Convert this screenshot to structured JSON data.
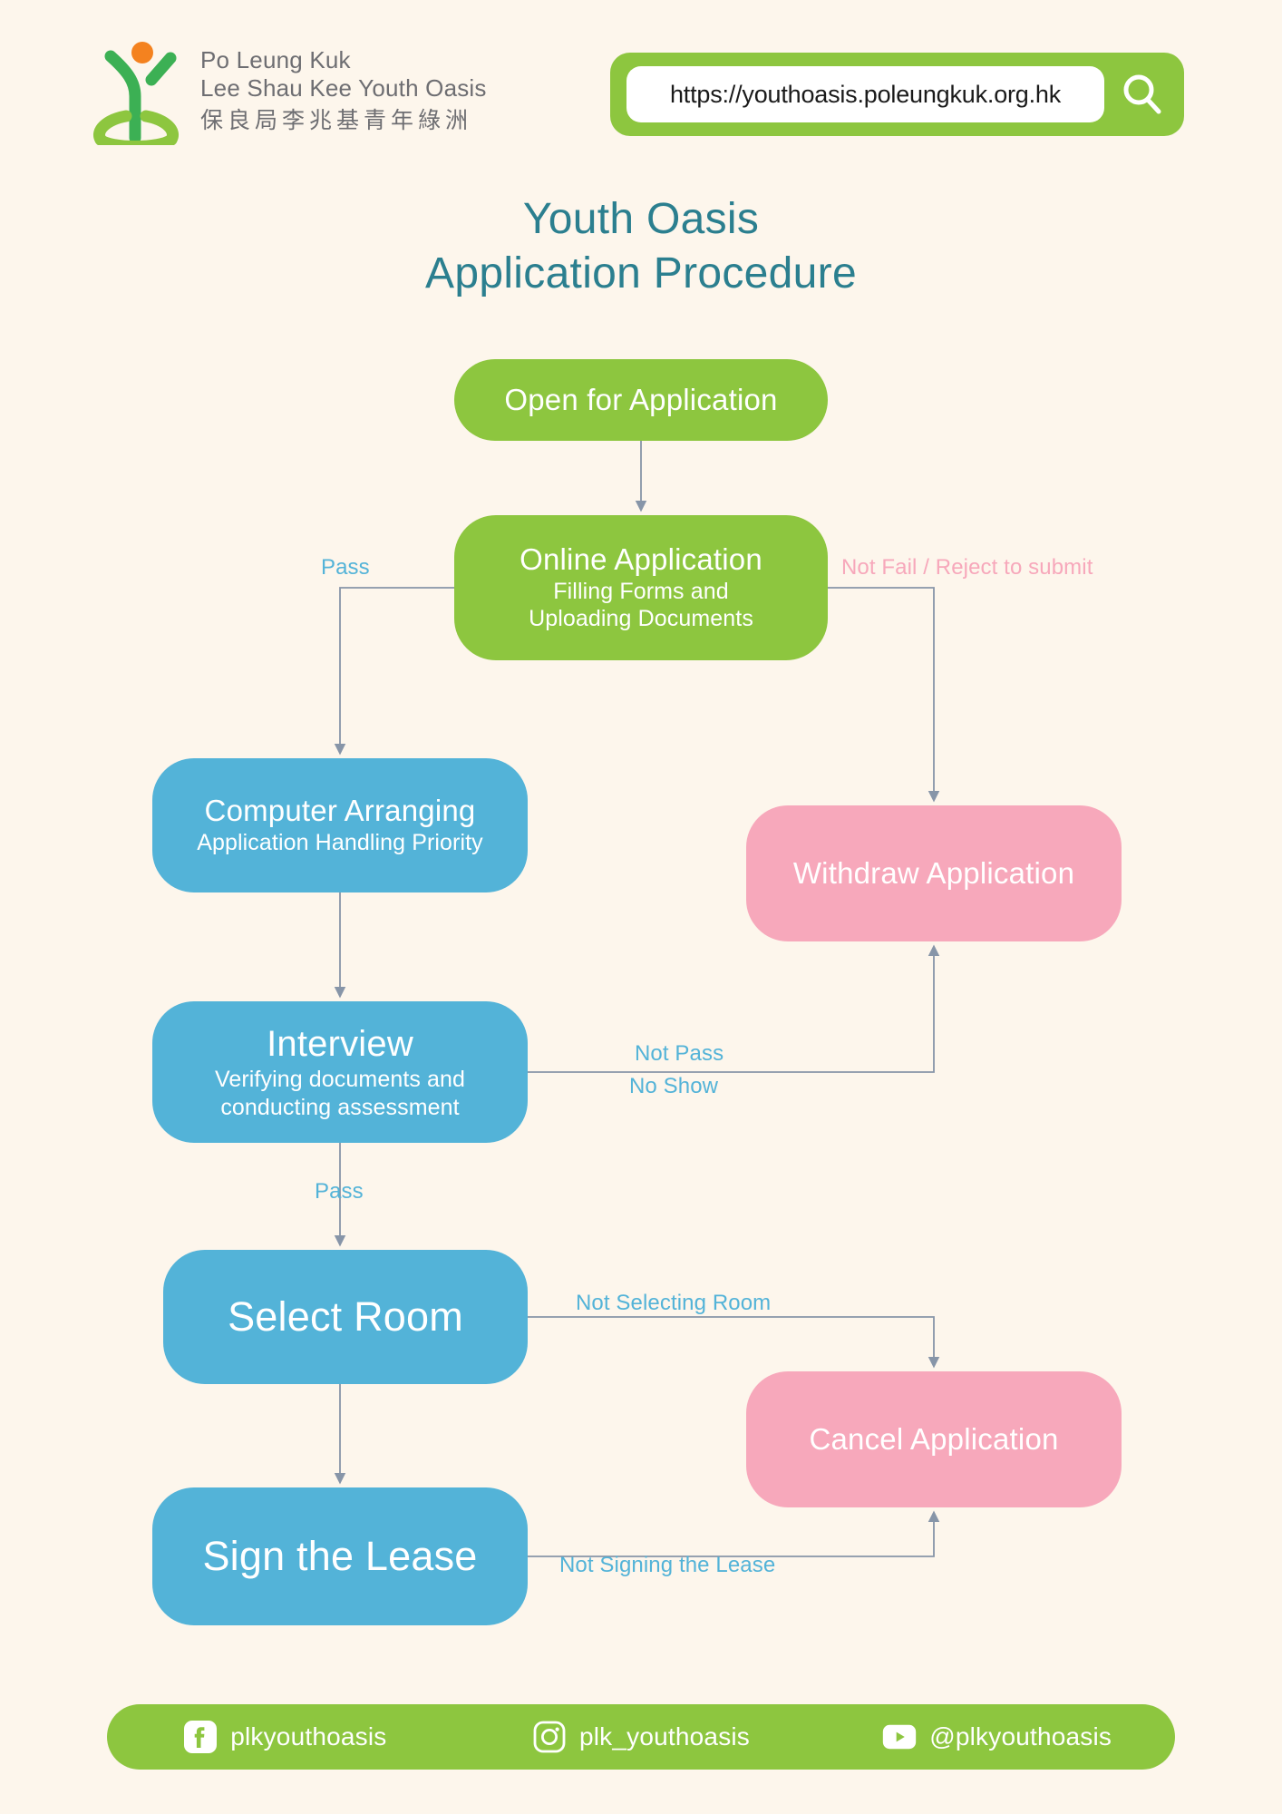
{
  "header": {
    "logo": {
      "icon_name": "plk-youth-oasis-logo",
      "line_en_1": "Po Leung Kuk",
      "line_en_2": "Lee Shau Kee Youth Oasis",
      "line_zh": "保良局李兆基青年綠洲",
      "colors": {
        "stem": "#3cb054",
        "arc": "#8dc63f",
        "dot": "#f4821f"
      }
    },
    "url_bar": {
      "url": "https://youthoasis.poleungkuk.org.hk",
      "placeholder": "https://youthoasis.poleungkuk.org.hk",
      "search_icon": "search-icon",
      "bar_color": "#8dc63f"
    }
  },
  "title": {
    "line1": "Youth Oasis",
    "line2": "Application Procedure",
    "color": "#2b7f8f"
  },
  "chart_data": {
    "type": "diagram",
    "title": "Youth Oasis Application Procedure",
    "colors": {
      "green": "#8dc63f",
      "blue": "#53b3d8",
      "pink": "#f7a8bb",
      "background": "#fdf6ec",
      "edge": "#8795a8"
    },
    "nodes": [
      {
        "id": "open",
        "title": "Open for Application",
        "subtitle": "",
        "color": "green"
      },
      {
        "id": "online",
        "title": "Online Application",
        "subtitle": "Filling Forms and\nUploading Documents",
        "color": "green"
      },
      {
        "id": "computer",
        "title": "Computer Arranging",
        "subtitle": "Application Handling Priority",
        "color": "blue"
      },
      {
        "id": "withdraw",
        "title": "Withdraw Application",
        "subtitle": "",
        "color": "pink"
      },
      {
        "id": "interview",
        "title": "Interview",
        "subtitle": "Verifying documents and\nconducting assessment",
        "color": "blue"
      },
      {
        "id": "select",
        "title": "Select Room",
        "subtitle": "",
        "color": "blue"
      },
      {
        "id": "cancel",
        "title": "Cancel Application",
        "subtitle": "",
        "color": "pink"
      },
      {
        "id": "sign",
        "title": "Sign the Lease",
        "subtitle": "",
        "color": "blue"
      }
    ],
    "edges": [
      {
        "from": "open",
        "to": "online",
        "label": ""
      },
      {
        "from": "online",
        "to": "computer",
        "label": "Pass",
        "label_color": "blue"
      },
      {
        "from": "online",
        "to": "withdraw",
        "label": "Not Fail / Reject to submit",
        "label_color": "pink"
      },
      {
        "from": "computer",
        "to": "interview",
        "label": ""
      },
      {
        "from": "interview",
        "to": "withdraw",
        "label": "Not Pass",
        "label2": "No Show",
        "label_color": "blue"
      },
      {
        "from": "interview",
        "to": "select",
        "label": "Pass",
        "label_color": "blue"
      },
      {
        "from": "select",
        "to": "cancel",
        "label": "Not Selecting Room",
        "label_color": "blue"
      },
      {
        "from": "select",
        "to": "sign",
        "label": ""
      },
      {
        "from": "sign",
        "to": "cancel",
        "label": "Not Signing the Lease",
        "label_color": "blue"
      }
    ]
  },
  "nodes": {
    "open": {
      "title": "Open for Application"
    },
    "online": {
      "title": "Online Application",
      "sub1": "Filling Forms and",
      "sub2": "Uploading Documents"
    },
    "computer": {
      "title": "Computer Arranging",
      "sub1": "Application Handling Priority"
    },
    "withdraw": {
      "title": "Withdraw Application"
    },
    "interview": {
      "title": "Interview",
      "sub1": "Verifying documents and",
      "sub2": "conducting assessment"
    },
    "select": {
      "title": "Select Room"
    },
    "cancel": {
      "title": "Cancel Application"
    },
    "sign": {
      "title": "Sign the Lease"
    }
  },
  "edge_labels": {
    "pass_1": "Pass",
    "not_fail": "Not Fail / Reject to submit",
    "not_pass": "Not Pass",
    "no_show": "No Show",
    "pass_2": "Pass",
    "not_selecting_room": "Not Selecting Room",
    "not_signing_lease": "Not Signing the Lease"
  },
  "footer": {
    "bar_color": "#8dc63f",
    "socials": [
      {
        "icon": "facebook-icon",
        "handle": "plkyouthoasis"
      },
      {
        "icon": "instagram-icon",
        "handle": "plk_youthoasis"
      },
      {
        "icon": "youtube-icon",
        "handle": "@plkyouthoasis"
      }
    ]
  }
}
